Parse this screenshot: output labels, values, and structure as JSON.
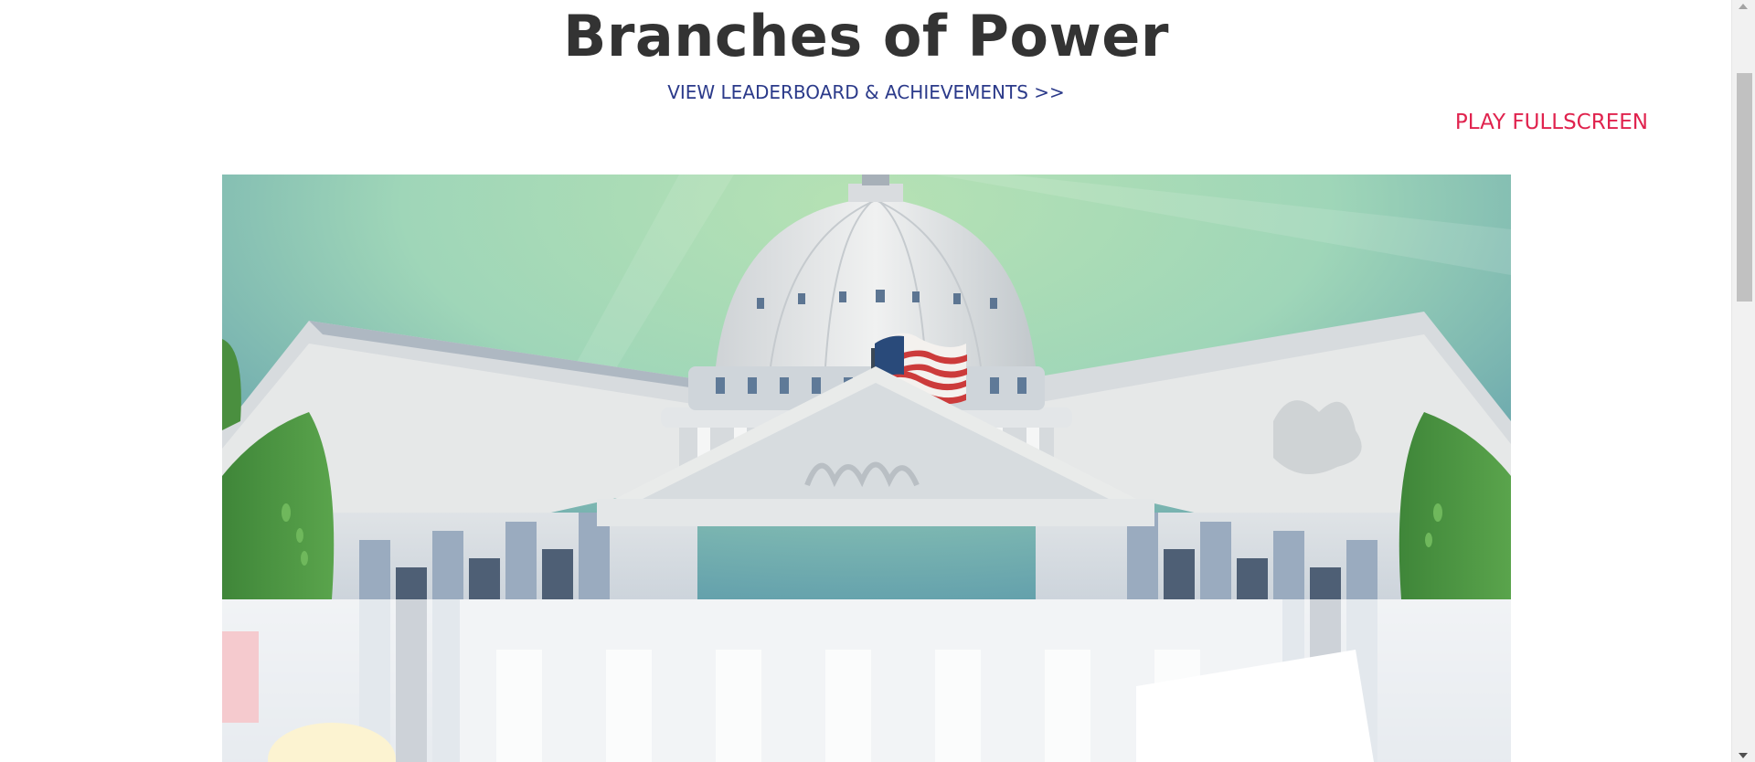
{
  "page": {
    "title": "Branches of Power",
    "leaderboard_link": "VIEW LEADERBOARD & ACHIEVEMENTS >>",
    "fullscreen_link": "PLAY FULLSCREEN"
  },
  "colors": {
    "title": "#333333",
    "leaderboard_link": "#2b3a8a",
    "fullscreen_link": "#e0234e",
    "sky_top": "#5a9ab0",
    "sky_glow": "#a8dcb0",
    "building": "#dfe3e8",
    "tree": "#4a8f3f"
  },
  "game": {
    "scene_icon": "capitol-building-illustration",
    "flag_icon": "us-flag-icon"
  }
}
